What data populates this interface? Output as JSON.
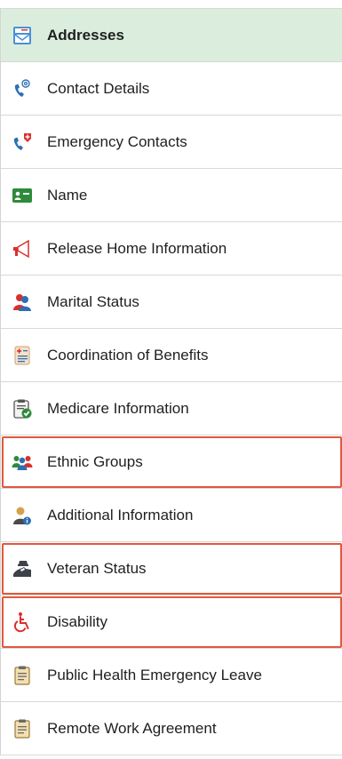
{
  "nav": {
    "items": [
      {
        "label": "Addresses",
        "icon": "envelope-icon",
        "active": true
      },
      {
        "label": "Contact Details",
        "icon": "phone-at-icon"
      },
      {
        "label": "Emergency Contacts",
        "icon": "emergency-phone-icon"
      },
      {
        "label": "Name",
        "icon": "id-card-icon"
      },
      {
        "label": "Release Home Information",
        "icon": "megaphone-icon"
      },
      {
        "label": "Marital Status",
        "icon": "couple-icon"
      },
      {
        "label": "Coordination of Benefits",
        "icon": "medical-clipboard-icon"
      },
      {
        "label": "Medicare Information",
        "icon": "clipboard-check-icon"
      },
      {
        "label": "Ethnic Groups",
        "icon": "group-people-icon",
        "highlighted": true
      },
      {
        "label": "Additional Information",
        "icon": "person-info-icon"
      },
      {
        "label": "Veteran Status",
        "icon": "veteran-icon",
        "highlighted": true
      },
      {
        "label": "Disability",
        "icon": "wheelchair-icon",
        "highlighted": true
      },
      {
        "label": "Public Health Emergency Leave",
        "icon": "clipboard-icon"
      },
      {
        "label": "Remote Work Agreement",
        "icon": "clipboard-icon"
      }
    ]
  },
  "colors": {
    "active_background": "#dbeede",
    "highlight_border": "#e0593c",
    "icon_blue": "#2c6fb5",
    "icon_red": "#d9302c",
    "icon_green": "#2e8b3a"
  }
}
